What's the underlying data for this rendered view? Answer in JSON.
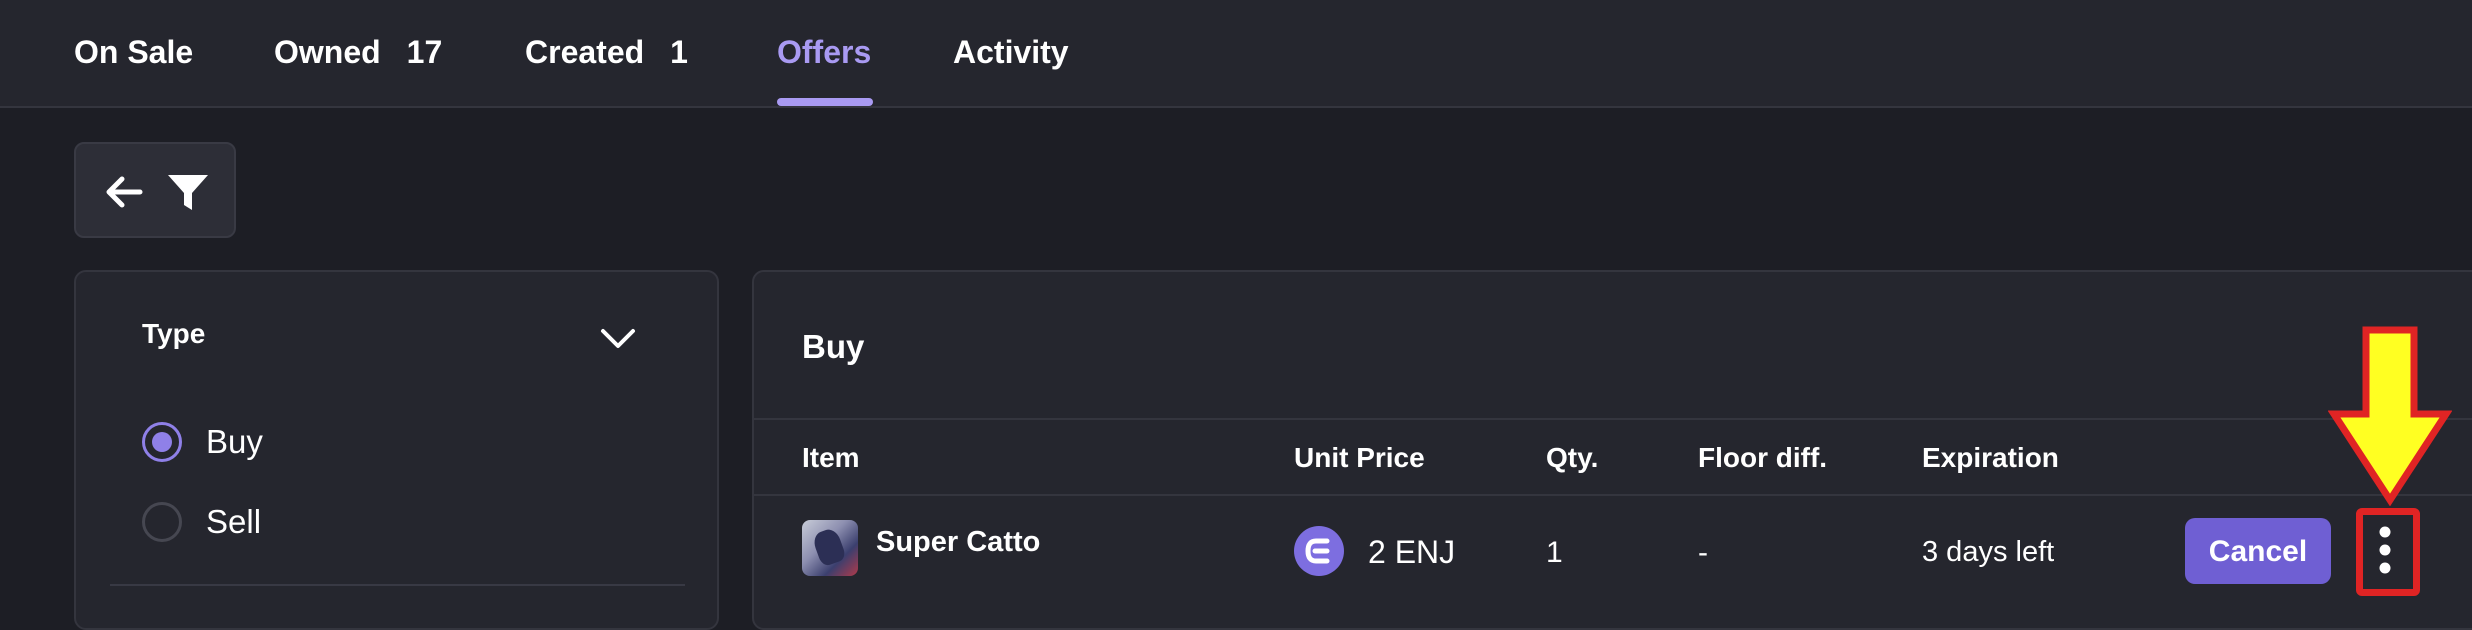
{
  "tabs": [
    {
      "label": "On Sale",
      "count": ""
    },
    {
      "label": "Owned",
      "count": "17"
    },
    {
      "label": "Created",
      "count": "1"
    },
    {
      "label": "Offers",
      "count": ""
    },
    {
      "label": "Activity",
      "count": ""
    }
  ],
  "active_tab": "Offers",
  "filter_panel": {
    "title": "Type",
    "options": [
      {
        "label": "Buy",
        "checked": true
      },
      {
        "label": "Sell",
        "checked": false
      }
    ]
  },
  "offers": {
    "section_title": "Buy",
    "columns": [
      "Item",
      "Unit Price",
      "Qty.",
      "Floor diff.",
      "Expiration"
    ],
    "rows": [
      {
        "item": "Super Catto",
        "unit_price": "2 ENJ",
        "qty": "1",
        "floor_diff": "-",
        "expiration": "3 days left",
        "action_label": "Cancel"
      }
    ]
  },
  "icons": {
    "back": "arrow-left-icon",
    "filter": "filter-funnel-icon",
    "collapse": "chevron-down-icon",
    "currency": "enjin-coin-icon",
    "more": "more-vertical-icon"
  },
  "colors": {
    "accent": "#a99af2",
    "button": "#6f5fd3",
    "annotation_arrow": "#ffff22",
    "annotation_outline": "#e02424"
  }
}
